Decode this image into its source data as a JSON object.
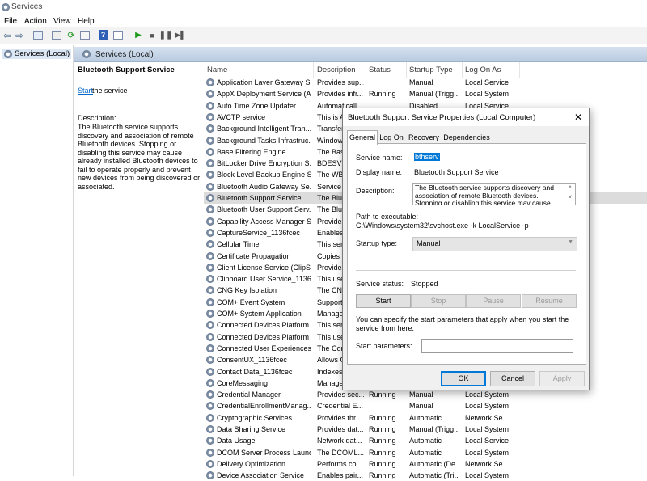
{
  "window": {
    "title": "Services"
  },
  "menu": [
    "File",
    "Action",
    "View",
    "Help"
  ],
  "tree": {
    "root": "Services (Local)"
  },
  "main": {
    "header": "Services (Local)"
  },
  "details": {
    "service_title": "Bluetooth Support Service",
    "start_link": "Start",
    "start_suffix": "the service",
    "description_label": "Description:",
    "description": "The Bluetooth service supports discovery and association of remote Bluetooth devices.  Stopping or disabling this service may cause already installed Bluetooth devices to fail to operate properly and prevent new devices from being discovered or associated."
  },
  "columns": [
    "Name",
    "Description",
    "Status",
    "Startup Type",
    "Log On As"
  ],
  "services": [
    {
      "name": "Application Layer Gateway S...",
      "desc": "Provides sup...",
      "status": "",
      "startup": "Manual",
      "logon": "Local Service"
    },
    {
      "name": "AppX Deployment Service (A...",
      "desc": "Provides infr...",
      "status": "Running",
      "startup": "Manual (Trigg...",
      "logon": "Local System"
    },
    {
      "name": "Auto Time Zone Updater",
      "desc": "Automaticall...",
      "status": "",
      "startup": "Disabled",
      "logon": "Local Service"
    },
    {
      "name": "AVCTP service",
      "desc": "This is Au...",
      "status": "",
      "startup": "",
      "logon": ""
    },
    {
      "name": "Background Intelligent Tran...",
      "desc": "Transfers...",
      "status": "",
      "startup": "",
      "logon": ""
    },
    {
      "name": "Background Tasks Infrastruc...",
      "desc": "Windows...",
      "status": "",
      "startup": "",
      "logon": ""
    },
    {
      "name": "Base Filtering Engine",
      "desc": "The Basi...",
      "status": "",
      "startup": "",
      "logon": ""
    },
    {
      "name": "BitLocker Drive Encryption S...",
      "desc": "BDESVC...",
      "status": "",
      "startup": "",
      "logon": ""
    },
    {
      "name": "Block Level Backup Engine S...",
      "desc": "The WB...",
      "status": "",
      "startup": "",
      "logon": ""
    },
    {
      "name": "Bluetooth Audio Gateway Se...",
      "desc": "Service s...",
      "status": "",
      "startup": "",
      "logon": ""
    },
    {
      "name": "Bluetooth Support Service",
      "desc": "The Blue...",
      "status": "",
      "startup": "",
      "logon": ""
    },
    {
      "name": "Bluetooth User Support Serv...",
      "desc": "The Blue...",
      "status": "",
      "startup": "",
      "logon": ""
    },
    {
      "name": "Capability Access Manager S...",
      "desc": "Provides...",
      "status": "",
      "startup": "",
      "logon": ""
    },
    {
      "name": "CaptureService_1136fcec",
      "desc": "Enables...",
      "status": "",
      "startup": "",
      "logon": ""
    },
    {
      "name": "Cellular Time",
      "desc": "This serv...",
      "status": "",
      "startup": "",
      "logon": ""
    },
    {
      "name": "Certificate Propagation",
      "desc": "Copies u...",
      "status": "",
      "startup": "",
      "logon": ""
    },
    {
      "name": "Client License Service (ClipSV...",
      "desc": "Provides...",
      "status": "",
      "startup": "",
      "logon": ""
    },
    {
      "name": "Clipboard User Service_1136...",
      "desc": "This use...",
      "status": "",
      "startup": "",
      "logon": ""
    },
    {
      "name": "CNG Key Isolation",
      "desc": "The CNG...",
      "status": "",
      "startup": "",
      "logon": ""
    },
    {
      "name": "COM+ Event System",
      "desc": "Supports...",
      "status": "",
      "startup": "",
      "logon": ""
    },
    {
      "name": "COM+ System Application",
      "desc": "Manages...",
      "status": "",
      "startup": "",
      "logon": ""
    },
    {
      "name": "Connected Devices Platform ...",
      "desc": "This serv...",
      "status": "",
      "startup": "",
      "logon": ""
    },
    {
      "name": "Connected Devices Platform ...",
      "desc": "This use...",
      "status": "",
      "startup": "",
      "logon": ""
    },
    {
      "name": "Connected User Experiences ...",
      "desc": "The Con...",
      "status": "",
      "startup": "",
      "logon": ""
    },
    {
      "name": "ConsentUX_1136fcec",
      "desc": "Allows C...",
      "status": "",
      "startup": "",
      "logon": ""
    },
    {
      "name": "Contact Data_1136fcec",
      "desc": "Indexes...",
      "status": "",
      "startup": "",
      "logon": ""
    },
    {
      "name": "CoreMessaging",
      "desc": "Manages...",
      "status": "",
      "startup": "",
      "logon": ""
    },
    {
      "name": "Credential Manager",
      "desc": "Provides sec...",
      "status": "Running",
      "startup": "Manual",
      "logon": "Local System"
    },
    {
      "name": "CredentialEnrollmentManag...",
      "desc": "Credential E...",
      "status": "",
      "startup": "Manual",
      "logon": "Local System"
    },
    {
      "name": "Cryptographic Services",
      "desc": "Provides thr...",
      "status": "Running",
      "startup": "Automatic",
      "logon": "Network Se..."
    },
    {
      "name": "Data Sharing Service",
      "desc": "Provides dat...",
      "status": "Running",
      "startup": "Manual (Trigg...",
      "logon": "Local System"
    },
    {
      "name": "Data Usage",
      "desc": "Network dat...",
      "status": "Running",
      "startup": "Automatic",
      "logon": "Local Service"
    },
    {
      "name": "DCOM Server Process Launc...",
      "desc": "The DCOML...",
      "status": "Running",
      "startup": "Automatic",
      "logon": "Local System"
    },
    {
      "name": "Delivery Optimization",
      "desc": "Performs co...",
      "status": "Running",
      "startup": "Automatic (De...",
      "logon": "Network Se..."
    },
    {
      "name": "Device Association Service",
      "desc": "Enables pair...",
      "status": "Running",
      "startup": "Automatic (Tri...",
      "logon": "Local System"
    }
  ],
  "selected_index": 10,
  "dialog": {
    "title": "Bluetooth Support Service Properties (Local Computer)",
    "close": "✕",
    "tabs": [
      "General",
      "Log On",
      "Recovery",
      "Dependencies"
    ],
    "service_name_label": "Service name:",
    "service_name": "bthserv",
    "display_name_label": "Display name:",
    "display_name": "Bluetooth Support Service",
    "description_label": "Description:",
    "description": "The Bluetooth service supports discovery and association of remote Bluetooth devices.  Stopping or disabling this service may cause already installed",
    "path_label": "Path to executable:",
    "path": "C:\\Windows\\system32\\svchost.exe -k LocalService -p",
    "startup_label": "Startup type:",
    "startup": "Manual",
    "status_label": "Service status:",
    "status": "Stopped",
    "buttons": {
      "start": "Start",
      "stop": "Stop",
      "pause": "Pause",
      "resume": "Resume"
    },
    "hint": "You can specify the start parameters that apply when you start the service from here.",
    "params_label": "Start parameters:",
    "params_value": "",
    "ok": "OK",
    "cancel": "Cancel",
    "apply": "Apply"
  }
}
